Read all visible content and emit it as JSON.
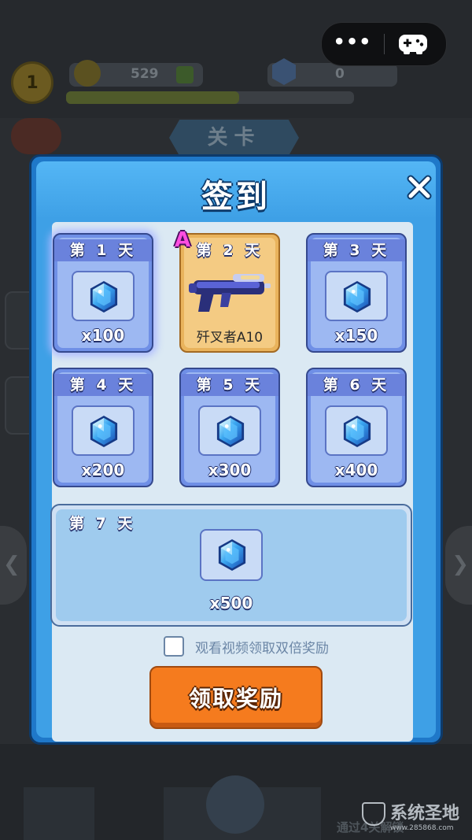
{
  "capsule": {
    "more_label": "•••",
    "game_icon": "gamepad-icon"
  },
  "background": {
    "level": "1",
    "coins": "529",
    "gems": "0",
    "stage_label": "关卡",
    "bottom_text": "通过4关解锁"
  },
  "watermark": {
    "brand": "系统圣地",
    "url": "www.285868.com"
  },
  "dialog": {
    "title": "签到",
    "close_icon": "close-icon",
    "days": [
      {
        "label": "第 1 天",
        "reward_type": "gem",
        "amount": "x100",
        "state": "current"
      },
      {
        "label": "第 2 天",
        "reward_type": "weapon",
        "rarity": "A",
        "amount": "歼叉者A10"
      },
      {
        "label": "第 3 天",
        "reward_type": "gem",
        "amount": "x150"
      },
      {
        "label": "第 4 天",
        "reward_type": "gem",
        "amount": "x200"
      },
      {
        "label": "第 5 天",
        "reward_type": "gem",
        "amount": "x300"
      },
      {
        "label": "第 6 天",
        "reward_type": "gem",
        "amount": "x400"
      },
      {
        "label": "第 7 天",
        "reward_type": "gem",
        "amount": "x500"
      }
    ],
    "double_reward_text": "观看视频领取双倍奖励",
    "double_reward_checked": false,
    "claim_button": "领取奖励"
  },
  "colors": {
    "dialog_blue": "#3ea0e6",
    "card_blue": "#9db8f2",
    "special_card": "#f4cb83",
    "claim_orange": "#f57b1e",
    "rarity_pink": "#ff4de0"
  }
}
